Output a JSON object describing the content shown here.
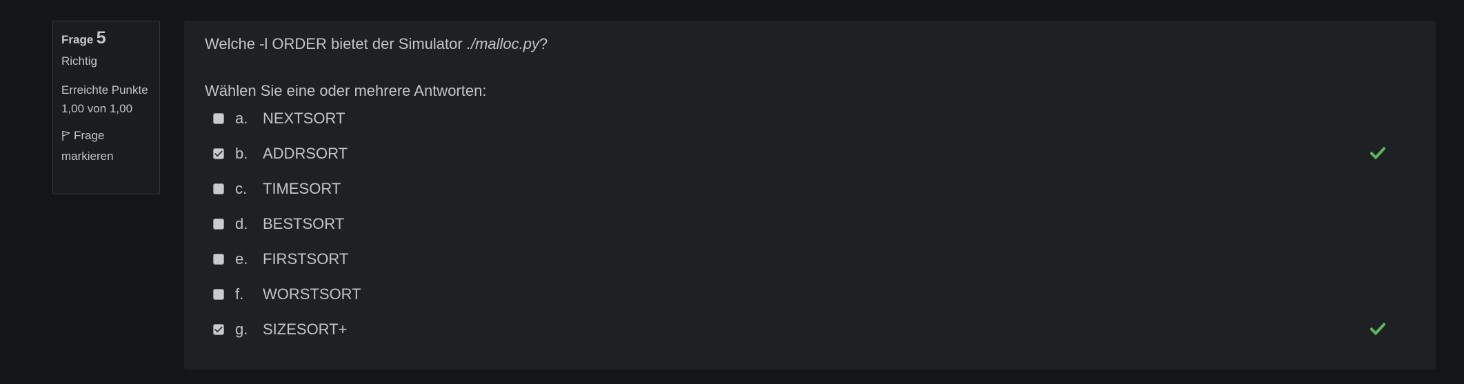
{
  "info": {
    "question_label": "Frage",
    "question_number": "5",
    "state": "Richtig",
    "grade": "Erreichte Punkte 1,00 von 1,00",
    "flag_label": "Frage markieren"
  },
  "question": {
    "text_before": "Welche -l ORDER bietet der Simulator ",
    "text_italic": "./malloc.py",
    "text_after": "?",
    "prompt": "Wählen Sie eine oder mehrere Antworten:",
    "options": [
      {
        "letter": "a.",
        "label": "NEXTSORT",
        "checked": false,
        "correct": false
      },
      {
        "letter": "b.",
        "label": "ADDRSORT",
        "checked": true,
        "correct": true
      },
      {
        "letter": "c.",
        "label": "TIMESORT",
        "checked": false,
        "correct": false
      },
      {
        "letter": "d.",
        "label": "BESTSORT",
        "checked": false,
        "correct": false
      },
      {
        "letter": "e.",
        "label": "FIRSTSORT",
        "checked": false,
        "correct": false
      },
      {
        "letter": "f.",
        "label": "WORSTSORT",
        "checked": false,
        "correct": false
      },
      {
        "letter": "g.",
        "label": "SIZESORT+",
        "checked": true,
        "correct": true
      }
    ]
  },
  "colors": {
    "background": "#141518",
    "panel": "#1f2023",
    "text": "#c2c5c8",
    "correct_tick": "#5cb85c"
  }
}
